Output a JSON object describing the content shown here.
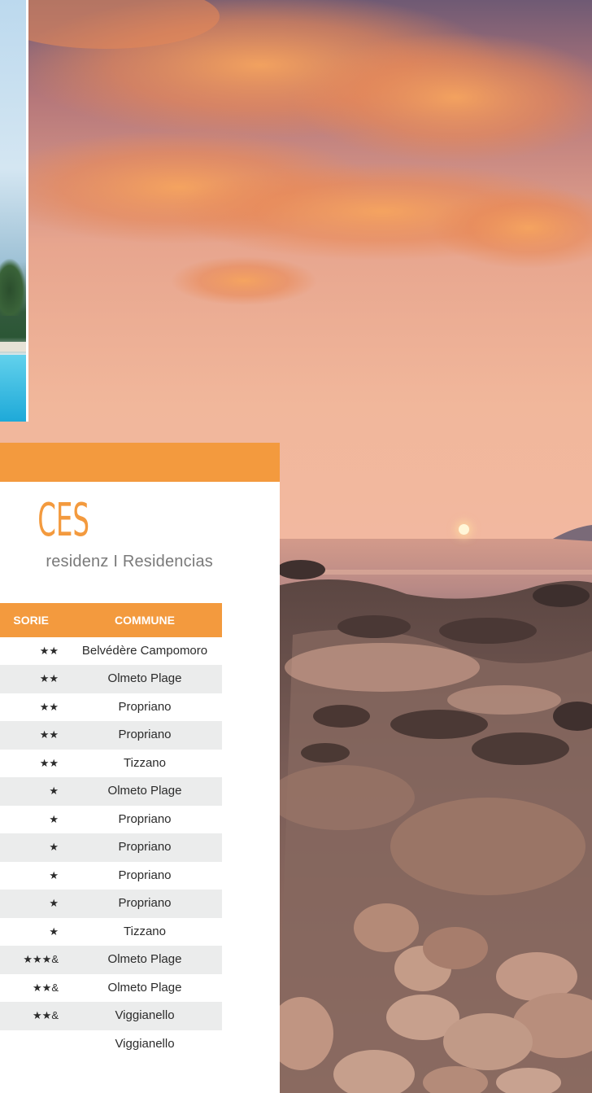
{
  "title": "CES",
  "subtitle": "residenz I Residencias",
  "table": {
    "headers": {
      "category": "SORIE",
      "commune": "COMMUNE"
    },
    "rows": [
      {
        "category": "★★",
        "commune": "Belvédère Campomoro"
      },
      {
        "category": "★★",
        "commune": "Olmeto Plage"
      },
      {
        "category": "★★",
        "commune": "Propriano"
      },
      {
        "category": "★★",
        "commune": "Propriano"
      },
      {
        "category": "★★",
        "commune": "Tizzano"
      },
      {
        "category": "★",
        "commune": "Olmeto Plage"
      },
      {
        "category": "★",
        "commune": "Propriano"
      },
      {
        "category": "★",
        "commune": "Propriano"
      },
      {
        "category": "★",
        "commune": "Propriano"
      },
      {
        "category": "★",
        "commune": "Propriano"
      },
      {
        "category": "★",
        "commune": "Tizzano"
      },
      {
        "category": "&★★★",
        "commune": "Olmeto Plage"
      },
      {
        "category": "&★★",
        "commune": "Olmeto Plage"
      },
      {
        "category": "&★★",
        "commune": "Viggianello"
      },
      {
        "category": "",
        "commune": "Viggianello"
      }
    ]
  },
  "colors": {
    "accent": "#f39a3e",
    "row_alt": "#ebecec",
    "subtitle": "#7a7a7a"
  }
}
